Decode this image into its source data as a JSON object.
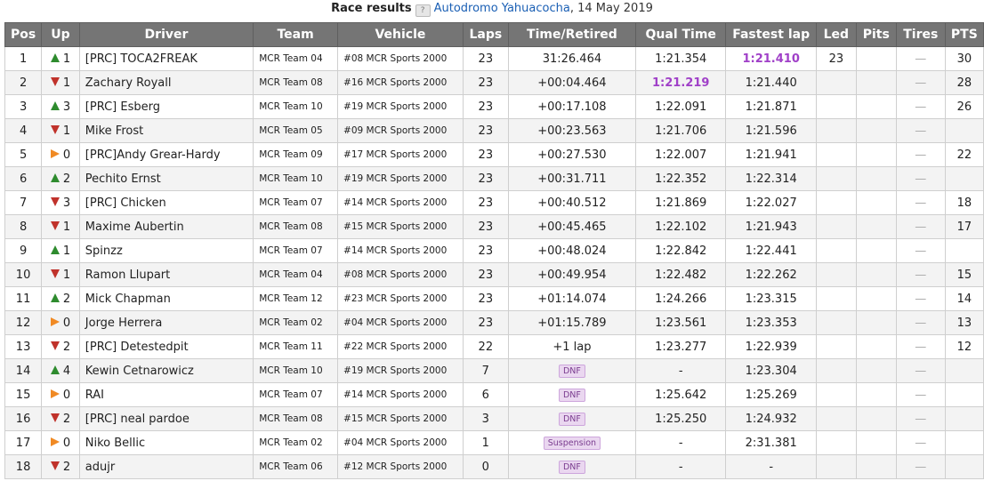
{
  "caption": {
    "title": "Race results",
    "link": "Autodromo Yahuacocha",
    "date": ", 14 May 2019"
  },
  "columns": [
    "Pos",
    "Up",
    "Driver",
    "Team",
    "Vehicle",
    "Laps",
    "Time/Retired",
    "Qual Time",
    "Fastest lap",
    "Led",
    "Pits",
    "Tires",
    "PTS"
  ],
  "colors": {
    "up": "#2e8b2e",
    "down": "#c0322b",
    "same": "#f08a24",
    "best_lap": "#a040c8",
    "header_bg": "#757575",
    "badge_bg": "#ead7f0"
  },
  "rows": [
    {
      "pos": "1",
      "dir": "up",
      "up": "1",
      "driver": "[PRC] TOCA2FREAK",
      "team": "MCR Team 04",
      "vehicle": "#08 MCR Sports 2000",
      "laps": "23",
      "time": "31:26.464",
      "time_badge": false,
      "qual": "1:21.354",
      "qual_best": false,
      "fast": "1:21.410",
      "fast_best": true,
      "led": "23",
      "pits": "",
      "tires": "—",
      "pts": "30"
    },
    {
      "pos": "2",
      "dir": "down",
      "up": "1",
      "driver": "Zachary Royall",
      "team": "MCR Team 08",
      "vehicle": "#16 MCR Sports 2000",
      "laps": "23",
      "time": "+00:04.464",
      "time_badge": false,
      "qual": "1:21.219",
      "qual_best": true,
      "fast": "1:21.440",
      "fast_best": false,
      "led": "",
      "pits": "",
      "tires": "—",
      "pts": "28"
    },
    {
      "pos": "3",
      "dir": "up",
      "up": "3",
      "driver": "[PRC] Esberg",
      "team": "MCR Team 10",
      "vehicle": "#19 MCR Sports 2000",
      "laps": "23",
      "time": "+00:17.108",
      "time_badge": false,
      "qual": "1:22.091",
      "qual_best": false,
      "fast": "1:21.871",
      "fast_best": false,
      "led": "",
      "pits": "",
      "tires": "—",
      "pts": "26"
    },
    {
      "pos": "4",
      "dir": "down",
      "up": "1",
      "driver": "Mike Frost",
      "team": "MCR Team 05",
      "vehicle": "#09 MCR Sports 2000",
      "laps": "23",
      "time": "+00:23.563",
      "time_badge": false,
      "qual": "1:21.706",
      "qual_best": false,
      "fast": "1:21.596",
      "fast_best": false,
      "led": "",
      "pits": "",
      "tires": "—",
      "pts": ""
    },
    {
      "pos": "5",
      "dir": "same",
      "up": "0",
      "driver": "[PRC]Andy Grear-Hardy",
      "team": "MCR Team 09",
      "vehicle": "#17 MCR Sports 2000",
      "laps": "23",
      "time": "+00:27.530",
      "time_badge": false,
      "qual": "1:22.007",
      "qual_best": false,
      "fast": "1:21.941",
      "fast_best": false,
      "led": "",
      "pits": "",
      "tires": "—",
      "pts": "22"
    },
    {
      "pos": "6",
      "dir": "up",
      "up": "2",
      "driver": "Pechito Ernst",
      "team": "MCR Team 10",
      "vehicle": "#19 MCR Sports 2000",
      "laps": "23",
      "time": "+00:31.711",
      "time_badge": false,
      "qual": "1:22.352",
      "qual_best": false,
      "fast": "1:22.314",
      "fast_best": false,
      "led": "",
      "pits": "",
      "tires": "—",
      "pts": ""
    },
    {
      "pos": "7",
      "dir": "down",
      "up": "3",
      "driver": "[PRC] Chicken",
      "team": "MCR Team 07",
      "vehicle": "#14 MCR Sports 2000",
      "laps": "23",
      "time": "+00:40.512",
      "time_badge": false,
      "qual": "1:21.869",
      "qual_best": false,
      "fast": "1:22.027",
      "fast_best": false,
      "led": "",
      "pits": "",
      "tires": "—",
      "pts": "18"
    },
    {
      "pos": "8",
      "dir": "down",
      "up": "1",
      "driver": "Maxime Aubertin",
      "team": "MCR Team 08",
      "vehicle": "#15 MCR Sports 2000",
      "laps": "23",
      "time": "+00:45.465",
      "time_badge": false,
      "qual": "1:22.102",
      "qual_best": false,
      "fast": "1:21.943",
      "fast_best": false,
      "led": "",
      "pits": "",
      "tires": "—",
      "pts": "17"
    },
    {
      "pos": "9",
      "dir": "up",
      "up": "1",
      "driver": "Spinzz",
      "team": "MCR Team 07",
      "vehicle": "#14 MCR Sports 2000",
      "laps": "23",
      "time": "+00:48.024",
      "time_badge": false,
      "qual": "1:22.842",
      "qual_best": false,
      "fast": "1:22.441",
      "fast_best": false,
      "led": "",
      "pits": "",
      "tires": "—",
      "pts": ""
    },
    {
      "pos": "10",
      "dir": "down",
      "up": "1",
      "driver": "Ramon Llupart",
      "team": "MCR Team 04",
      "vehicle": "#08 MCR Sports 2000",
      "laps": "23",
      "time": "+00:49.954",
      "time_badge": false,
      "qual": "1:22.482",
      "qual_best": false,
      "fast": "1:22.262",
      "fast_best": false,
      "led": "",
      "pits": "",
      "tires": "—",
      "pts": "15"
    },
    {
      "pos": "11",
      "dir": "up",
      "up": "2",
      "driver": "Mick Chapman",
      "team": "MCR Team 12",
      "vehicle": "#23 MCR Sports 2000",
      "laps": "23",
      "time": "+01:14.074",
      "time_badge": false,
      "qual": "1:24.266",
      "qual_best": false,
      "fast": "1:23.315",
      "fast_best": false,
      "led": "",
      "pits": "",
      "tires": "—",
      "pts": "14"
    },
    {
      "pos": "12",
      "dir": "same",
      "up": "0",
      "driver": "Jorge Herrera",
      "team": "MCR Team 02",
      "vehicle": "#04 MCR Sports 2000",
      "laps": "23",
      "time": "+01:15.789",
      "time_badge": false,
      "qual": "1:23.561",
      "qual_best": false,
      "fast": "1:23.353",
      "fast_best": false,
      "led": "",
      "pits": "",
      "tires": "—",
      "pts": "13"
    },
    {
      "pos": "13",
      "dir": "down",
      "up": "2",
      "driver": "[PRC] Detestedpit",
      "team": "MCR Team 11",
      "vehicle": "#22 MCR Sports 2000",
      "laps": "22",
      "time": "+1 lap",
      "time_badge": false,
      "qual": "1:23.277",
      "qual_best": false,
      "fast": "1:22.939",
      "fast_best": false,
      "led": "",
      "pits": "",
      "tires": "—",
      "pts": "12"
    },
    {
      "pos": "14",
      "dir": "up",
      "up": "4",
      "driver": "Kewin Cetnarowicz",
      "team": "MCR Team 10",
      "vehicle": "#19 MCR Sports 2000",
      "laps": "7",
      "time": "DNF",
      "time_badge": true,
      "qual": "-",
      "qual_best": false,
      "fast": "1:23.304",
      "fast_best": false,
      "led": "",
      "pits": "",
      "tires": "—",
      "pts": ""
    },
    {
      "pos": "15",
      "dir": "same",
      "up": "0",
      "driver": "RAI",
      "team": "MCR Team 07",
      "vehicle": "#14 MCR Sports 2000",
      "laps": "6",
      "time": "DNF",
      "time_badge": true,
      "qual": "1:25.642",
      "qual_best": false,
      "fast": "1:25.269",
      "fast_best": false,
      "led": "",
      "pits": "",
      "tires": "—",
      "pts": ""
    },
    {
      "pos": "16",
      "dir": "down",
      "up": "2",
      "driver": "[PRC] neal pardoe",
      "team": "MCR Team 08",
      "vehicle": "#15 MCR Sports 2000",
      "laps": "3",
      "time": "DNF",
      "time_badge": true,
      "qual": "1:25.250",
      "qual_best": false,
      "fast": "1:24.932",
      "fast_best": false,
      "led": "",
      "pits": "",
      "tires": "—",
      "pts": ""
    },
    {
      "pos": "17",
      "dir": "same",
      "up": "0",
      "driver": "Niko Bellic",
      "team": "MCR Team 02",
      "vehicle": "#04 MCR Sports 2000",
      "laps": "1",
      "time": "Suspension",
      "time_badge": true,
      "qual": "-",
      "qual_best": false,
      "fast": "2:31.381",
      "fast_best": false,
      "led": "",
      "pits": "",
      "tires": "—",
      "pts": ""
    },
    {
      "pos": "18",
      "dir": "down",
      "up": "2",
      "driver": "adujr",
      "team": "MCR Team 06",
      "vehicle": "#12 MCR Sports 2000",
      "laps": "0",
      "time": "DNF",
      "time_badge": true,
      "qual": "-",
      "qual_best": false,
      "fast": "-",
      "fast_best": false,
      "led": "",
      "pits": "",
      "tires": "—",
      "pts": ""
    }
  ]
}
